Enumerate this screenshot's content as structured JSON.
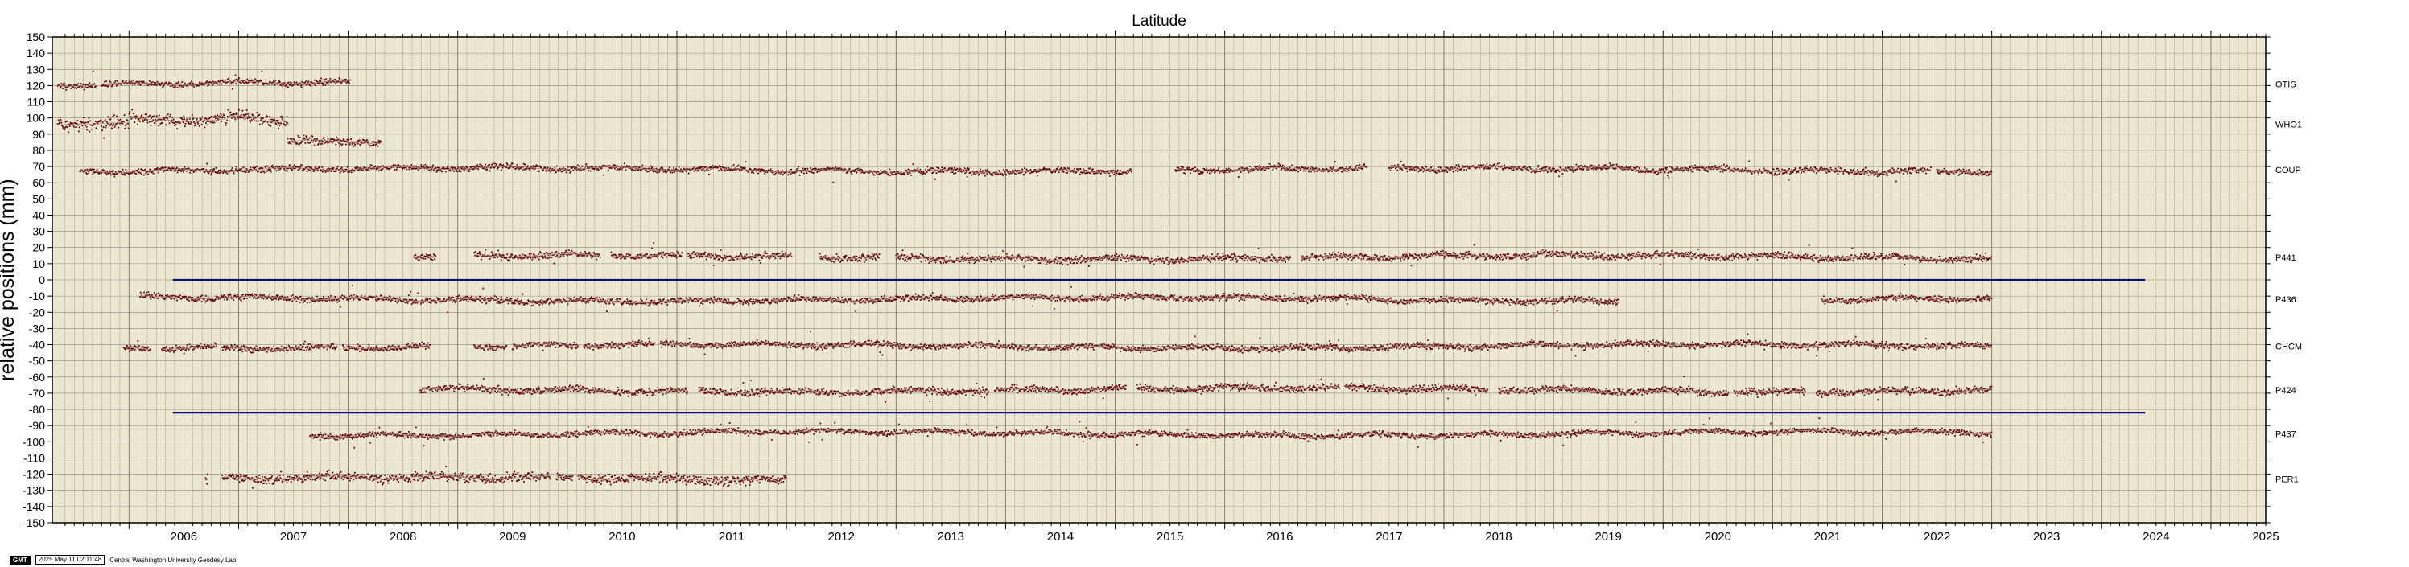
{
  "chart_data": {
    "type": "scatter",
    "title": "Latitude",
    "ylabel": "relative positions (mm)",
    "xlabel": "",
    "xlim": [
      2005.3,
      2025.5
    ],
    "ylim": [
      -150,
      150
    ],
    "y_tick_step": 10,
    "x_tick_labels": [
      "2006",
      "2007",
      "2008",
      "2009",
      "2010",
      "2011",
      "2012",
      "2013",
      "2014",
      "2015",
      "2016",
      "2017",
      "2018",
      "2019",
      "2020",
      "2021",
      "2022",
      "2023",
      "2024",
      "2025"
    ],
    "grid": true,
    "colors": {
      "plot_bg": "#ece7d1",
      "points": "#6b0d0d",
      "fit_line": "#9a9a9a",
      "reference_line": "#0d0d80"
    },
    "reference_lines": [
      {
        "y": 0,
        "x_start": 2006.4,
        "x_end": 2024.4
      },
      {
        "y": -82,
        "x_start": 2006.4,
        "x_end": 2024.4
      }
    ],
    "series": [
      {
        "name": "OTIS",
        "offset": 121,
        "noise": 1.6,
        "segments": [
          [
            2005.35,
            2005.7
          ],
          [
            2005.75,
            2008.02
          ]
        ]
      },
      {
        "name": "WHO1",
        "offset": 96,
        "noise": 3.2,
        "segments": [
          [
            2005.35,
            2007.45
          ]
        ],
        "steps": [
          [
            2005.35,
            96
          ],
          [
            2006.0,
            99
          ],
          [
            2006.9,
            101
          ],
          [
            2007.2,
            99
          ]
        ]
      },
      {
        "name": "WHO1",
        "offset": 85,
        "noise": 2.2,
        "segments": [
          [
            2007.45,
            2008.3
          ]
        ]
      },
      {
        "name": "COUP",
        "offset": 68,
        "noise": 1.6,
        "segments": [
          [
            2005.55,
            2015.15
          ],
          [
            2015.55,
            2017.3
          ],
          [
            2017.5,
            2022.45
          ],
          [
            2022.5,
            2023.0
          ]
        ]
      },
      {
        "name": "P441",
        "offset": 14,
        "noise": 1.8,
        "segments": [
          [
            2008.6,
            2008.8
          ],
          [
            2009.15,
            2010.3
          ],
          [
            2010.4,
            2011.05
          ],
          [
            2011.1,
            2012.05
          ],
          [
            2012.3,
            2012.85
          ],
          [
            2013.0,
            2013.5
          ],
          [
            2013.5,
            2015.2
          ],
          [
            2015.2,
            2016.05
          ],
          [
            2016.05,
            2016.6
          ],
          [
            2016.7,
            2023.0
          ]
        ]
      },
      {
        "name": "P436",
        "offset": -12,
        "noise": 1.6,
        "segments": [
          [
            2006.1,
            2019.6
          ],
          [
            2021.45,
            2023.0
          ]
        ]
      },
      {
        "name": "CHCM",
        "offset": -41,
        "noise": 1.6,
        "segments": [
          [
            2005.95,
            2006.2
          ],
          [
            2006.3,
            2006.8
          ],
          [
            2006.85,
            2007.9
          ],
          [
            2007.95,
            2008.05
          ],
          [
            2008.05,
            2008.75
          ],
          [
            2009.15,
            2009.45
          ],
          [
            2009.5,
            2010.1
          ],
          [
            2010.15,
            2010.8
          ],
          [
            2010.85,
            2016.65
          ],
          [
            2016.65,
            2017.5
          ],
          [
            2017.5,
            2017.75
          ],
          [
            2017.75,
            2019.25
          ],
          [
            2019.25,
            2023.0
          ]
        ]
      },
      {
        "name": "P424",
        "offset": -68,
        "noise": 1.8,
        "segments": [
          [
            2008.65,
            2011.1
          ],
          [
            2011.2,
            2013.85
          ],
          [
            2013.9,
            2015.1
          ],
          [
            2015.2,
            2017.05
          ],
          [
            2017.1,
            2018.4
          ],
          [
            2018.5,
            2020.6
          ],
          [
            2020.65,
            2021.3
          ],
          [
            2021.4,
            2023.0
          ]
        ]
      },
      {
        "name": "P437",
        "offset": -95,
        "noise": 1.4,
        "segments": [
          [
            2007.65,
            2023.0
          ]
        ]
      },
      {
        "name": "PER1",
        "offset": -123,
        "noise": 2.4,
        "segments": [
          [
            2006.7,
            2006.72
          ],
          [
            2006.85,
            2009.85
          ],
          [
            2009.9,
            2010.05
          ],
          [
            2010.1,
            2012.0
          ]
        ]
      }
    ]
  },
  "footer": {
    "logo": "GMT",
    "timestamp": "2025 May 11 02:11:48",
    "credit": "Central Washington University Geodesy Lab"
  }
}
